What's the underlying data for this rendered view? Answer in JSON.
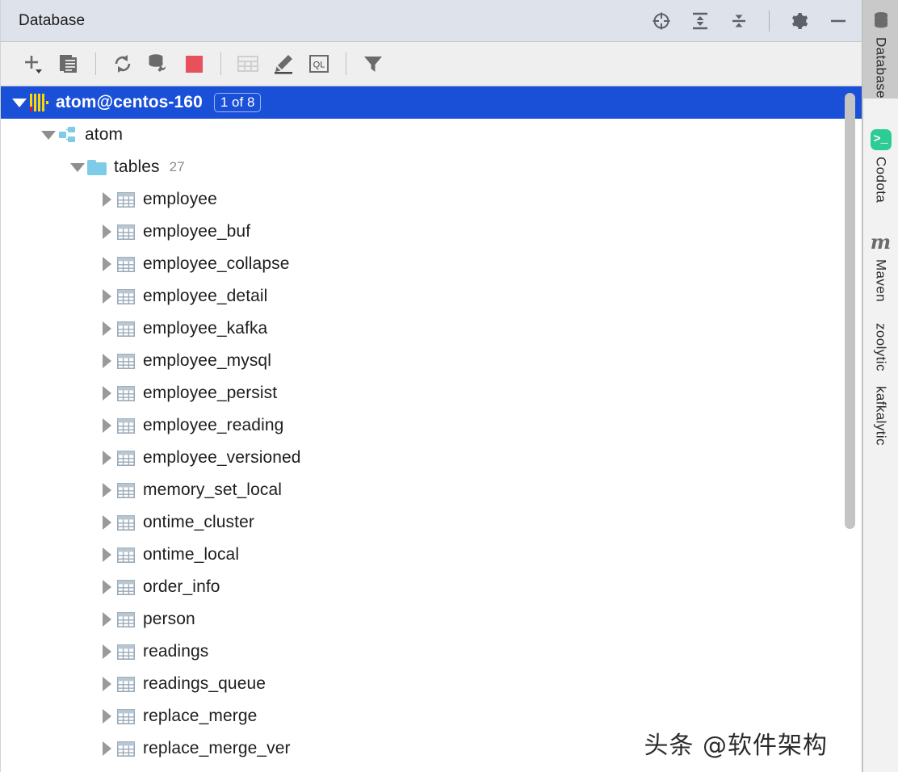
{
  "window": {
    "title": "Database",
    "header_buttons": [
      {
        "name": "locate-icon",
        "tooltip": "Scroll from Source"
      },
      {
        "name": "expand-all-icon",
        "tooltip": "Expand All"
      },
      {
        "name": "collapse-all-icon",
        "tooltip": "Collapse All"
      },
      {
        "name": "gear-icon",
        "tooltip": "Settings"
      },
      {
        "name": "minimize-icon",
        "tooltip": "Hide"
      }
    ]
  },
  "toolbar": {
    "buttons": [
      {
        "name": "add-button",
        "tooltip": "New"
      },
      {
        "name": "duplicate-button",
        "tooltip": "Duplicate"
      },
      {
        "name": "refresh-button",
        "tooltip": "Refresh"
      },
      {
        "name": "db-tools-button",
        "tooltip": "Database Tools"
      },
      {
        "name": "stop-button",
        "tooltip": "Stop",
        "color": "#e8505b"
      },
      {
        "name": "table-editor-button",
        "tooltip": "Data Editor",
        "disabled": true
      },
      {
        "name": "modify-button",
        "tooltip": "Modify"
      },
      {
        "name": "query-console-button",
        "tooltip": "Query Console",
        "label": "QL"
      },
      {
        "name": "filter-button",
        "tooltip": "Filter"
      }
    ]
  },
  "tree": {
    "root": {
      "label": "atom@centos-160",
      "badge": "1 of 8",
      "expanded": true,
      "selected": true
    },
    "schema": {
      "label": "atom",
      "expanded": true
    },
    "tables_group": {
      "label": "tables",
      "count": "27",
      "expanded": true
    },
    "tables": [
      {
        "label": "employee"
      },
      {
        "label": "employee_buf"
      },
      {
        "label": "employee_collapse"
      },
      {
        "label": "employee_detail"
      },
      {
        "label": "employee_kafka"
      },
      {
        "label": "employee_mysql"
      },
      {
        "label": "employee_persist"
      },
      {
        "label": "employee_reading"
      },
      {
        "label": "employee_versioned"
      },
      {
        "label": "memory_set_local"
      },
      {
        "label": "ontime_cluster"
      },
      {
        "label": "ontime_local"
      },
      {
        "label": "order_info"
      },
      {
        "label": "person"
      },
      {
        "label": "readings"
      },
      {
        "label": "readings_queue"
      },
      {
        "label": "replace_merge"
      },
      {
        "label": "replace_merge_ver"
      }
    ]
  },
  "stripe": {
    "tabs": [
      {
        "label": "Database",
        "icon": "database-icon",
        "active": true
      },
      {
        "label": "Codota",
        "icon": "codota-icon",
        "active": false
      },
      {
        "label": "Maven",
        "icon": "maven-icon",
        "active": false
      },
      {
        "label": "zoolytic",
        "icon": "",
        "active": false
      },
      {
        "label": "kafkalytic",
        "icon": "",
        "active": false
      }
    ]
  },
  "watermark": {
    "text": "头条 @软件架构"
  },
  "colors": {
    "selection": "#1a50d8",
    "header_bg": "#dee2ea",
    "toolbar_bg": "#efefef",
    "stop_red": "#e8505b",
    "codota_green": "#2ecc95",
    "folder_blue": "#7ecbe8",
    "clickhouse_yellow": "#ffd800",
    "clickhouse_red": "#e8122b"
  }
}
